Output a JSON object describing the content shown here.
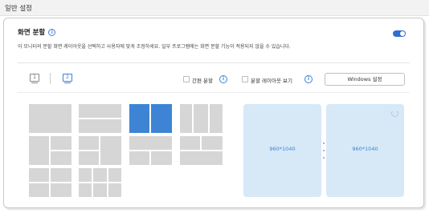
{
  "header": {
    "title": "일반 설정"
  },
  "section": {
    "title": "화면 분할",
    "info_icon": "info-circle-icon",
    "toggle_on": true,
    "description": "이 모니터의 분할 화면 레이아웃을 선택하고 사용자에 맞게 조정하세요. 일부 프로그램에는 화면 분할 기능이 적용되지 않을 수 있습니다."
  },
  "toolbar": {
    "monitors": [
      {
        "label": "1",
        "selected": false
      },
      {
        "label": "2",
        "selected": true
      }
    ],
    "simple_split_label": "간편 분할",
    "show_layout_label": "분할 레이아웃 보기",
    "windows_settings_label": "Windows 설정"
  },
  "layouts": [
    {
      "name": "layout-single",
      "selected": false
    },
    {
      "name": "layout-two-rows",
      "selected": false
    },
    {
      "name": "layout-two-columns",
      "selected": true
    },
    {
      "name": "layout-three-columns",
      "selected": false
    },
    {
      "name": "layout-left-plus-two-right",
      "selected": false
    },
    {
      "name": "layout-two-left-plus-right",
      "selected": false
    },
    {
      "name": "layout-top-plus-two-bottom",
      "selected": false
    },
    {
      "name": "layout-two-top-plus-bottom",
      "selected": false
    },
    {
      "name": "layout-four-grid",
      "selected": false
    },
    {
      "name": "layout-six-grid",
      "selected": false
    }
  ],
  "displays": [
    {
      "label": "960*1040"
    },
    {
      "label": "960*1040"
    }
  ],
  "colors": {
    "accent": "#3d84d4",
    "tile": "#d6d6d6",
    "display_bg": "#d7e8f7"
  }
}
